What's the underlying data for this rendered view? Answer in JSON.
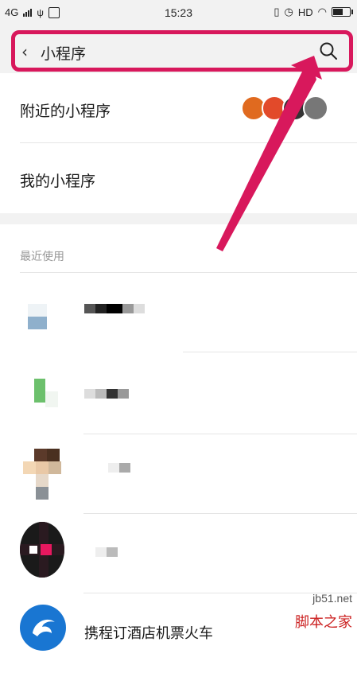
{
  "status_bar": {
    "network": "4G",
    "time": "15:23",
    "hd": "HD"
  },
  "header": {
    "search_text": "小程序",
    "back_icon": "chevron-left-icon",
    "search_icon": "search-icon",
    "highlight_color": "#d8185c"
  },
  "menu": {
    "nearby": "附近的小程序",
    "mine": "我的小程序"
  },
  "recent": {
    "section_title": "最近使用",
    "apps": [
      {
        "name": "",
        "blurred": true
      },
      {
        "name": "",
        "blurred": true
      },
      {
        "name": "",
        "blurred": true
      },
      {
        "name": "",
        "blurred": true
      },
      {
        "name": "携程订酒店机票火车",
        "blurred": false
      }
    ]
  },
  "watermark": {
    "site": "jb51.net",
    "brand": "脚本之家"
  },
  "colors": {
    "background": "#ffffff",
    "header_bg": "#f2f2f2",
    "accent_pink": "#d8185c"
  }
}
